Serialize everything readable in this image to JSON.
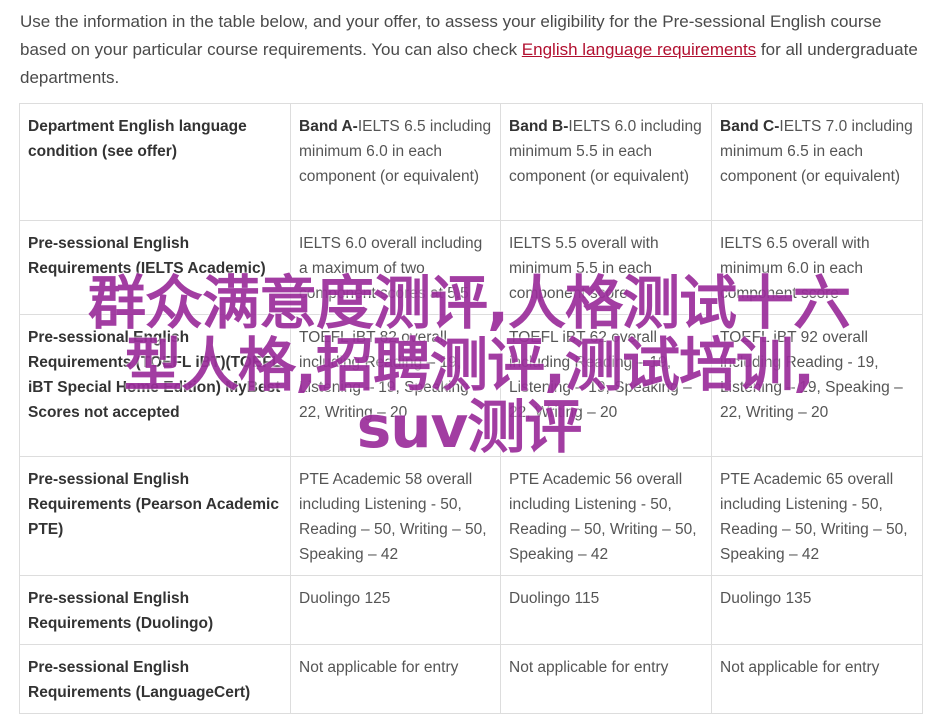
{
  "intro": {
    "text_before": "Use the information in the table below, and your offer, to assess your eligibility for the Pre-sessional English course based on your particular course requirements. You can also check ",
    "link": "English language requirements",
    "text_after": " for all undergraduate departments."
  },
  "table": {
    "header": {
      "col0": "Department English language condition (see offer)",
      "bands": [
        {
          "label": "Band A-",
          "text": "IELTS 6.5 including minimum 6.0 in each component (or equivalent)"
        },
        {
          "label": "Band B-",
          "text": "IELTS 6.0 including minimum 5.5 in each component (or equivalent)"
        },
        {
          "label": "Band C-",
          "text": "IELTS 7.0 including minimum 6.5 in each component (or equivalent)"
        }
      ]
    },
    "rows": [
      {
        "label": "Pre-sessional English Requirements (IELTS Academic)",
        "cells": [
          "IELTS 6.0 overall including a maximum of two component scores at 5.5",
          "IELTS 5.5 overall with minimum 5.5 in each component score",
          "IELTS 6.5 overall with minimum 6.0 in each component score"
        ]
      },
      {
        "label": "Pre-sessional English Requirements (TOEFL iBT)(TOEFL iBT Special Home Edition) MyBest Scores not accepted",
        "cells": [
          "TOEFL iBT 82 overall including Reading – 19, Listening – 19, Speaking – 22, Writing – 20",
          "TOEFL iBT 62 overall including Reading – 19, Listening – 19, Speaking – 22, Writing – 20",
          "TOEFL iBT 92 overall including Reading - 19, Listening – 19, Speaking – 22, Writing – 20"
        ]
      },
      {
        "label": "Pre-sessional English Requirements (Pearson Academic PTE)",
        "cells": [
          "PTE Academic 58 overall including Listening - 50, Reading – 50, Writing – 50, Speaking – 42",
          "PTE Academic 56 overall including Listening - 50, Reading – 50, Writing – 50, Speaking – 42",
          "PTE Academic 65 overall including Listening - 50, Reading – 50, Writing – 50, Speaking – 42"
        ]
      },
      {
        "label": "Pre-sessional English Requirements (Duolingo)",
        "cells": [
          "Duolingo 125",
          "Duolingo 115",
          "Duolingo 135"
        ]
      },
      {
        "label": "Pre-sessional English Requirements (LanguageCert)",
        "cells": [
          "Not applicable for entry",
          "Not applicable for entry",
          "Not applicable for entry"
        ]
      }
    ]
  },
  "watermark": {
    "line1": "群众满意度测评,人格测试十六",
    "line2": "型人格,招聘测评,测试培训,",
    "line3": "suv测评"
  },
  "colors": {
    "link": "#b21030",
    "watermark": "#9b2f9b",
    "border": "#dddddd"
  }
}
